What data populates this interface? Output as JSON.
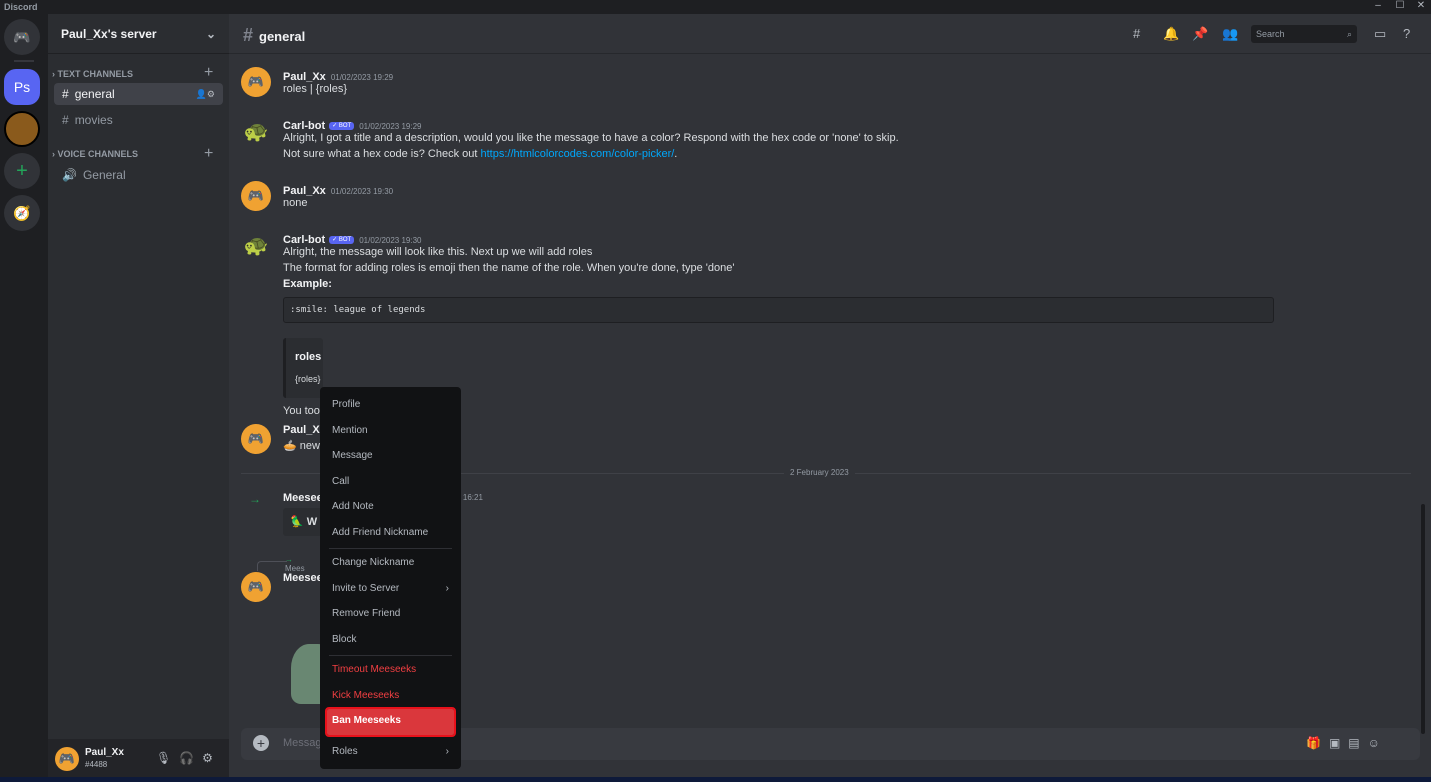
{
  "window": {
    "title": "Discord"
  },
  "servers": [
    {
      "label": "Ps",
      "color": "#5865f2"
    }
  ],
  "sidebar": {
    "server_name": "Paul_Xx's server",
    "text_category": "TEXT CHANNELS",
    "voice_category": "VOICE CHANNELS",
    "text_channels": [
      "general",
      "movies"
    ],
    "voice_channels": [
      "General"
    ]
  },
  "user": {
    "name": "Paul_Xx",
    "tag": "#4488"
  },
  "header": {
    "channel": "general",
    "search_placeholder": "Search"
  },
  "messages": [
    {
      "author": "Paul_Xx",
      "time": "01/02/2023 19:29",
      "lines": [
        "roles | {roles}"
      ]
    },
    {
      "author": "Carl-bot",
      "bot": "✓ BOT",
      "time": "01/02/2023 19:29",
      "lines": [
        "Alright, I got a title and a description, would you like the message to have a color? Respond with the hex code or 'none' to skip.",
        "Not sure what a hex code is? Check out "
      ],
      "link": "https://htmlcolorcodes.com/color-picker/"
    },
    {
      "author": "Paul_Xx",
      "time": "01/02/2023 19:30",
      "lines": [
        "none"
      ]
    },
    {
      "author": "Carl-bot",
      "bot": "✓ BOT",
      "time": "01/02/2023 19:30",
      "lines": [
        "Alright, the message will look like this. Next up we will add roles",
        "The format for adding roles is emoji then the name of the role. When you're done, type 'done'"
      ],
      "example_label": "Example:",
      "code": ":smile: league of legends",
      "embed_title": "roles",
      "embed_desc": "{roles}",
      "after": "You too"
    },
    {
      "author": "Paul_X",
      "lines": [
        "new"
      ]
    },
    {
      "author": "Meesee",
      "time": "at 16:21",
      "card": "W"
    },
    {
      "author": "Meesee",
      "reply": "Mees"
    }
  ],
  "date_divider": "2 February 2023",
  "input": {
    "placeholder": "Message"
  },
  "context_menu": {
    "items": [
      "Profile",
      "Mention",
      "Message",
      "Call",
      "Add Note",
      "Add Friend Nickname",
      "Change Nickname",
      "Invite to Server",
      "Remove Friend",
      "Block",
      "Timeout Meeseeks",
      "Kick Meeseeks",
      "Ban Meeseeks",
      "Roles"
    ],
    "highlighted": "Ban Meeseeks",
    "danger_color": "#f23f42"
  }
}
